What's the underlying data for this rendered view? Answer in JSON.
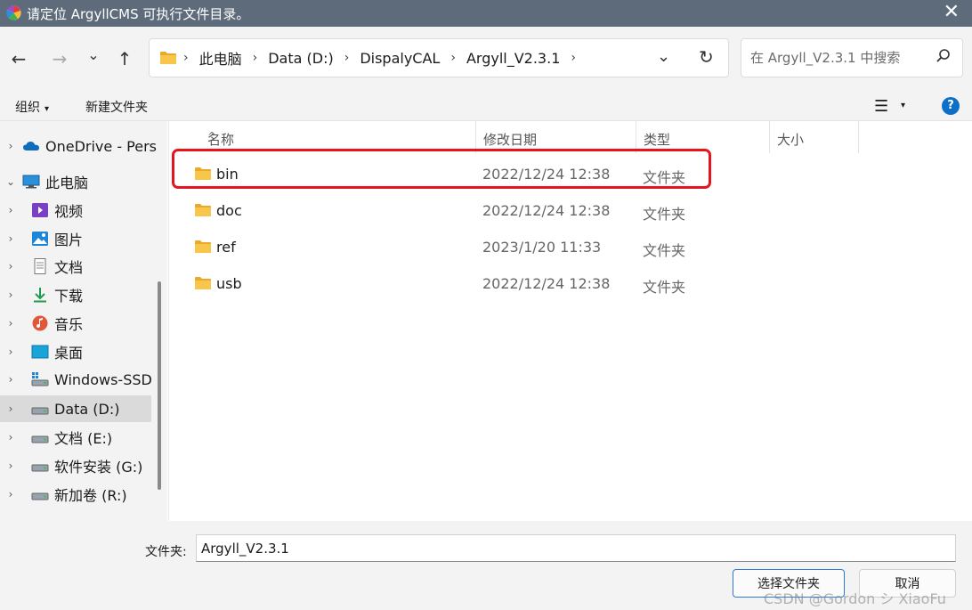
{
  "window": {
    "title": "请定位 ArgyllCMS 可执行文件目录。",
    "close_glyph": "✕"
  },
  "nav": {
    "back_glyph": "←",
    "forward_glyph": "→",
    "recent_glyph": "⌄",
    "up_glyph": "↑"
  },
  "address": {
    "crumbs": [
      "此电脑",
      "Data (D:)",
      "DispalyCAL",
      "Argyll_V2.3.1"
    ],
    "separator": "›",
    "dropdown_glyph": "⌄",
    "refresh_glyph": "↻"
  },
  "search": {
    "placeholder": "在 Argyll_V2.3.1 中搜索"
  },
  "commandbar": {
    "organize": "组织",
    "organize_caret": "▾",
    "new_folder": "新建文件夹",
    "view_glyph": "☰",
    "view_caret": "▾",
    "help_glyph": "?"
  },
  "sidebar": {
    "items": [
      {
        "label": "OneDrive - Pers",
        "icon": "cloud-icon",
        "chevron": "›"
      },
      {
        "label": "此电脑",
        "icon": "computer-icon",
        "chevron": "⌄"
      },
      {
        "label": "视频",
        "icon": "video-icon",
        "chevron": "›"
      },
      {
        "label": "图片",
        "icon": "pictures-icon",
        "chevron": "›"
      },
      {
        "label": "文档",
        "icon": "documents-icon",
        "chevron": "›"
      },
      {
        "label": "下载",
        "icon": "download-icon",
        "chevron": "›"
      },
      {
        "label": "音乐",
        "icon": "music-icon",
        "chevron": "›"
      },
      {
        "label": "桌面",
        "icon": "desktop-icon",
        "chevron": "›"
      },
      {
        "label": "Windows-SSD",
        "icon": "drive-icon",
        "chevron": "›"
      },
      {
        "label": "Data (D:)",
        "icon": "drive-icon",
        "chevron": "›",
        "selected": true
      },
      {
        "label": "文档 (E:)",
        "icon": "drive-icon",
        "chevron": "›"
      },
      {
        "label": "软件安装 (G:)",
        "icon": "drive-icon",
        "chevron": "›"
      },
      {
        "label": "新加卷 (R:)",
        "icon": "drive-icon",
        "chevron": "›"
      }
    ]
  },
  "columns": {
    "name": "名称",
    "modified": "修改日期",
    "type": "类型",
    "size": "大小",
    "sort_glyph": "^"
  },
  "files": [
    {
      "name": "bin",
      "modified": "2022/12/24 12:38",
      "type": "文件夹"
    },
    {
      "name": "doc",
      "modified": "2022/12/24 12:38",
      "type": "文件夹"
    },
    {
      "name": "ref",
      "modified": "2023/1/20 11:33",
      "type": "文件夹"
    },
    {
      "name": "usb",
      "modified": "2022/12/24 12:38",
      "type": "文件夹"
    }
  ],
  "footer": {
    "folder_label": "文件夹:",
    "folder_value": "Argyll_V2.3.1",
    "select_button": "选择文件夹",
    "cancel_button": "取消"
  },
  "watermark": "CSDN @Gordon シ XiaoFu",
  "colors": {
    "titlebar": "#5d6b7b",
    "highlight_box": "#e8141b",
    "folder": "#f7c64a",
    "accent": "#0e6fc9"
  }
}
